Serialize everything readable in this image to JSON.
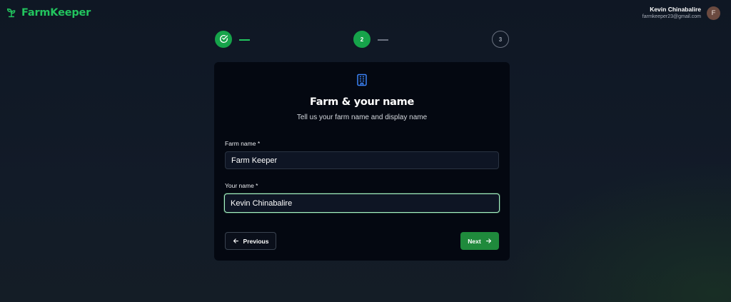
{
  "app": {
    "brand": "FarmKeeper",
    "brand_color": "#22c55e",
    "logo_icon": "sprout-icon"
  },
  "user": {
    "name": "Kevin Chinabalire",
    "email": "farmkeeper23@gmail.com",
    "avatar_initial": "F"
  },
  "stepper": {
    "steps": [
      {
        "state": "completed",
        "label": "",
        "icon": "check-circle-icon"
      },
      {
        "state": "active",
        "label": "2"
      },
      {
        "state": "pending",
        "label": "3"
      }
    ]
  },
  "card": {
    "icon": "building-icon",
    "icon_color": "#3b82f6",
    "title": "Farm & your name",
    "subtitle": "Tell us your farm name and display name"
  },
  "form": {
    "farm_name": {
      "label": "Farm name *",
      "value": "Farm Keeper"
    },
    "your_name": {
      "label": "Your name *",
      "value": "Kevin Chinabalire"
    }
  },
  "actions": {
    "previous_label": "Previous",
    "next_label": "Next",
    "next_color": "#1f8a3c"
  }
}
